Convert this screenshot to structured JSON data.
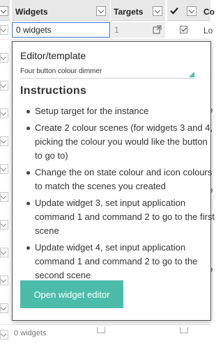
{
  "table": {
    "columns": {
      "widgets": "Widgets",
      "targets": "Targets",
      "next": "Co"
    },
    "active_row": {
      "widget_value": "0 widgets",
      "targets_value": "1",
      "checked": true,
      "next_cell": "Lo"
    },
    "partial_cells": [
      "Lo",
      "Lo",
      "Lo"
    ],
    "bottom_row_text": "0 widgets"
  },
  "popup": {
    "editor_label": "Editor/template",
    "template_value": "Four button colour dimmer",
    "instructions_title": "Instructions",
    "instructions": [
      "Setup target for the instance",
      "Create 2 colour scenes (for widgets 3 and 4, picking the colour you would like the button to go to)",
      "Change the on state colour and icon colours to match the scenes you created",
      "Update widget 3, set input application command 1 and command 2 to go to the first scene",
      "Update widget 4, set input application command 1 and command 2 to go to the second scene"
    ],
    "open_button_label": "Open widget editor"
  },
  "colors": {
    "accent": "#4cbcaa",
    "focus_border": "#3a78c8",
    "header_bg": "#e8e8e8"
  },
  "icons": {
    "external_link": "external-link-icon",
    "check": "check-icon",
    "dropdown": "chevron-down-icon"
  }
}
